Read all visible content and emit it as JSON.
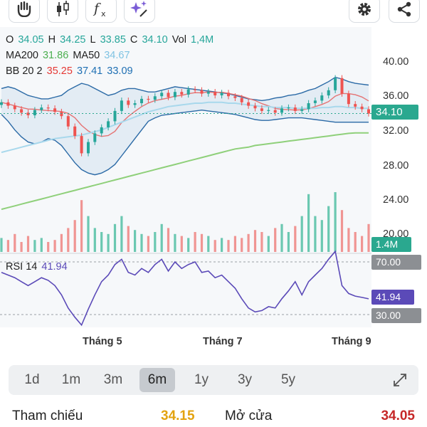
{
  "colors": {
    "up": "#26a69a",
    "down": "#ef5350",
    "accent_green": "#2e9e6a",
    "accent_red": "#c62828"
  },
  "toolbar": {
    "icons": [
      "hand-icon",
      "candlestick-icon",
      "function-icon",
      "sparkle-icon",
      "gear-icon",
      "share-icon"
    ]
  },
  "ohlc": {
    "o_label": "O",
    "o_value": "34.05",
    "h_label": "H",
    "h_value": "34.25",
    "l_label": "L",
    "l_value": "33.85",
    "c_label": "C",
    "c_value": "34.10",
    "vol_label": "Vol",
    "vol_value": "1,4M"
  },
  "ma": {
    "ma200_label": "MA200",
    "ma200_value": "31.86",
    "ma50_label": "MA50",
    "ma50_value": "34.67"
  },
  "bb": {
    "label": "BB 20 2",
    "upper": "35.25",
    "middle": "37.41",
    "lower": "33.09"
  },
  "price_axis": {
    "labels": [
      "40.00",
      "36.00",
      "32.00",
      "28.00",
      "24.00",
      "20.00"
    ],
    "current": "34.10",
    "volume": "1.4M"
  },
  "rsi": {
    "label": "RSI 14",
    "value": "41.94",
    "upper_level": "70.00",
    "lower_level": "30.00"
  },
  "x_axis": {
    "labels": [
      "Tháng 5",
      "Tháng 7",
      "Tháng 9"
    ]
  },
  "ranges": {
    "items": [
      "1d",
      "1m",
      "3m",
      "6m",
      "1y",
      "3y",
      "5y"
    ],
    "active": "6m"
  },
  "stats": {
    "ref_label": "Tham chiếu",
    "ref_value": "34.15",
    "open_label": "Mở cửa",
    "open_value": "34.05"
  },
  "chart_data": {
    "type": "line",
    "x_labels": [
      "Tháng 5",
      "Tháng 7",
      "Tháng 9"
    ],
    "ylim": [
      18,
      42
    ],
    "close": [
      35.4,
      35.0,
      34.6,
      34.2,
      33.9,
      34.5,
      34.8,
      34.7,
      34.3,
      33.8,
      32.6,
      31.5,
      29.5,
      30.8,
      31.8,
      32.5,
      33.2,
      34.4,
      35.6,
      35.1,
      35.3,
      35.8,
      35.7,
      36.1,
      36.5,
      36.0,
      36.6,
      36.3,
      36.9,
      36.8,
      36.4,
      36.6,
      36.2,
      36.5,
      36.1,
      35.9,
      35.4,
      35.0,
      34.7,
      34.4,
      34.5,
      34.2,
      34.7,
      34.8,
      34.4,
      34.6,
      35.3,
      35.6,
      36.2,
      36.8,
      38.2,
      36.4,
      35.2,
      34.9,
      34.6,
      34.1
    ],
    "ma50": [
      29.6,
      29.8,
      30.0,
      30.2,
      30.4,
      30.6,
      30.8,
      31.0,
      31.2,
      31.3,
      31.4,
      31.5,
      31.6,
      31.8,
      32.0,
      32.2,
      32.5,
      32.8,
      33.1,
      33.4,
      33.7,
      34.0,
      34.3,
      34.5,
      34.7,
      34.9,
      35.0,
      35.1,
      35.2,
      35.3,
      35.3,
      35.4,
      35.4,
      35.4,
      35.3,
      35.3,
      35.2,
      35.1,
      35.0,
      34.9,
      34.9,
      34.8,
      34.8,
      34.8,
      34.7,
      34.7,
      34.7,
      34.7,
      34.8,
      34.8,
      34.9,
      34.9,
      34.8,
      34.8,
      34.7,
      34.7
    ],
    "ma200": [
      23.0,
      23.2,
      23.4,
      23.6,
      23.8,
      24.0,
      24.2,
      24.4,
      24.6,
      24.8,
      25.0,
      25.2,
      25.4,
      25.6,
      25.8,
      26.0,
      26.2,
      26.4,
      26.6,
      26.8,
      27.0,
      27.2,
      27.4,
      27.6,
      27.8,
      28.0,
      28.2,
      28.4,
      28.6,
      28.8,
      29.0,
      29.2,
      29.4,
      29.6,
      29.8,
      30.0,
      30.1,
      30.2,
      30.4,
      30.5,
      30.6,
      30.7,
      30.8,
      30.9,
      31.0,
      31.1,
      31.2,
      31.3,
      31.4,
      31.5,
      31.6,
      31.7,
      31.8,
      31.85,
      31.86,
      31.86
    ],
    "bb_upper": [
      37.0,
      37.2,
      37.0,
      36.6,
      36.2,
      36.0,
      35.8,
      35.8,
      36.0,
      36.2,
      36.8,
      37.2,
      37.6,
      37.4,
      37.0,
      36.6,
      36.2,
      36.4,
      36.8,
      37.0,
      37.0,
      36.8,
      36.6,
      36.6,
      36.8,
      37.0,
      37.2,
      37.1,
      37.0,
      36.9,
      36.8,
      36.7,
      36.6,
      36.5,
      36.4,
      36.2,
      36.0,
      35.8,
      35.7,
      35.6,
      35.7,
      35.9,
      36.0,
      36.2,
      36.3,
      36.5,
      36.8,
      37.0,
      37.4,
      37.8,
      38.3,
      38.1,
      37.8,
      37.6,
      37.5,
      37.4
    ],
    "bb_lower": [
      34.0,
      33.2,
      32.2,
      31.4,
      30.8,
      30.6,
      30.8,
      31.2,
      31.0,
      30.4,
      29.4,
      28.4,
      27.6,
      27.2,
      27.0,
      27.2,
      27.6,
      28.2,
      29.2,
      30.2,
      31.2,
      32.2,
      33.2,
      33.6,
      33.9,
      34.0,
      34.1,
      34.2,
      34.3,
      34.4,
      34.5,
      34.4,
      34.3,
      34.2,
      34.1,
      34.0,
      33.8,
      33.6,
      33.4,
      33.3,
      33.3,
      33.4,
      33.5,
      33.6,
      33.6,
      33.6,
      33.5,
      33.4,
      33.3,
      33.2,
      33.1,
      33.1,
      33.1,
      33.1,
      33.1,
      33.1
    ],
    "volume": [
      0.7,
      0.6,
      0.9,
      0.5,
      0.8,
      0.6,
      0.7,
      0.5,
      0.6,
      0.9,
      1.2,
      1.6,
      2.6,
      1.8,
      1.2,
      1.0,
      0.9,
      1.4,
      1.8,
      1.3,
      1.1,
      0.9,
      0.8,
      1.0,
      1.4,
      1.2,
      0.9,
      0.8,
      0.7,
      1.0,
      0.9,
      0.8,
      0.6,
      0.7,
      0.6,
      0.8,
      0.7,
      0.9,
      1.1,
      1.0,
      0.8,
      1.2,
      1.4,
      1.0,
      1.3,
      1.8,
      2.9,
      1.8,
      1.6,
      2.3,
      3.0,
      2.1,
      1.2,
      1.0,
      0.8,
      1.4
    ],
    "volume_unit": "M",
    "rsi": [
      62,
      60,
      58,
      55,
      52,
      55,
      58,
      56,
      52,
      45,
      35,
      28,
      22,
      34,
      45,
      55,
      60,
      68,
      72,
      62,
      60,
      65,
      62,
      68,
      72,
      63,
      70,
      65,
      68,
      70,
      62,
      63,
      58,
      60,
      55,
      50,
      42,
      35,
      32,
      33,
      36,
      35,
      42,
      48,
      55,
      45,
      55,
      60,
      65,
      72,
      78,
      52,
      46,
      44,
      43,
      41.94
    ],
    "rsi_levels": [
      30,
      70
    ],
    "rsi_range": [
      20,
      80
    ]
  }
}
